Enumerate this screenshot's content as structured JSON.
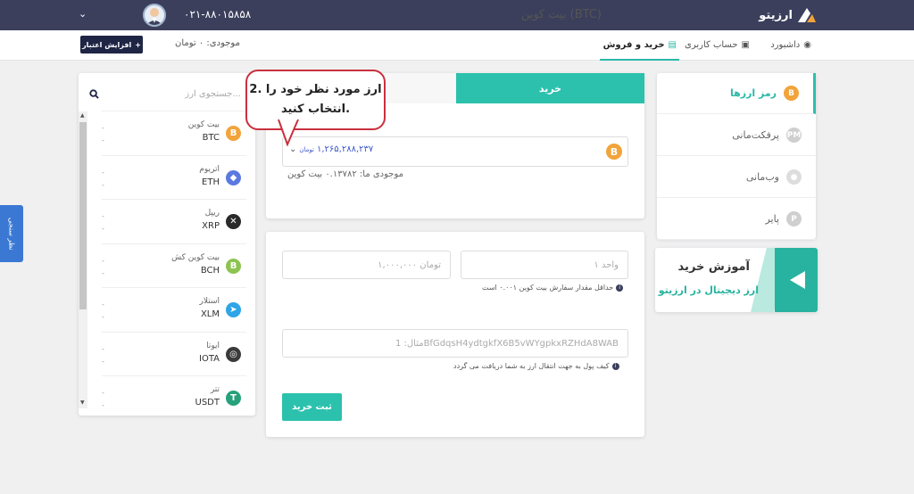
{
  "brand": {
    "name": "ارزیتو"
  },
  "header": {
    "phone": "۰۲۱-۸۸۰۱۵۸۵۸"
  },
  "nav": {
    "items": [
      {
        "label": "داشبورد",
        "icon": "dashboard-icon"
      },
      {
        "label": "حساب کاربری",
        "icon": "user-card-icon"
      },
      {
        "label": "خرید و فروش",
        "icon": "exchange-icon"
      }
    ]
  },
  "account": {
    "balance": "موجودی: ۰ تومان",
    "increase_label": "افزایش اعتبار"
  },
  "search": {
    "placeholder": "جستجوی ارز..."
  },
  "coins": [
    {
      "name": "بیت کوین",
      "symbol": "BTC",
      "color": "#f2a33a",
      "glyph": "B",
      "a": "-",
      "b": "-"
    },
    {
      "name": "اتریوم",
      "symbol": "ETH",
      "color": "#5b7ae0",
      "glyph": "◆",
      "a": "-",
      "b": "-"
    },
    {
      "name": "ریپل",
      "symbol": "XRP",
      "color": "#2a2a2a",
      "glyph": "✕",
      "a": "-",
      "b": "-"
    },
    {
      "name": "بیت کوین کش",
      "symbol": "BCH",
      "color": "#8dc451",
      "glyph": "B",
      "a": "-",
      "b": "-"
    },
    {
      "name": "استلار",
      "symbol": "XLM",
      "color": "#2fa4e7",
      "glyph": "➤",
      "a": "-",
      "b": "-"
    },
    {
      "name": "ایوتا",
      "symbol": "IOTA",
      "color": "#3a3a3a",
      "glyph": "◎",
      "a": "-",
      "b": "-"
    },
    {
      "name": "تتر",
      "symbol": "USDT",
      "color": "#26a17b",
      "glyph": "T",
      "a": "-",
      "b": "-"
    }
  ],
  "feedback": {
    "label": "نظر سنجی"
  },
  "trade": {
    "tab_buy": "خرید",
    "callout": "2. ارز مورد نظر خود را انتخاب کنید.",
    "selected_coin": "بیت کوین (BTC)",
    "price": "۱,۲۶۵,۲۸۸,۲۳۷",
    "price_unit": "تومان",
    "stock": "موجودی ما: ۰.۱۳۷۸۲ بیت کوین"
  },
  "form": {
    "units_placeholder": "۱ واحد",
    "toman_placeholder": "۱,۰۰۰,۰۰۰ تومان",
    "min_hint": "حداقل مقدار سفارش بیت کوین ۰.۰۰۱ است",
    "wallet_placeholder": "مثال: 1BfGdqsH4ydtgkfX6B5vWYgpkxRZHdA8WAB",
    "wallet_hint": "کیف پول به جهت انتقال ارز به شما دریافت می گردد",
    "submit": "ثبت خرید"
  },
  "menu": [
    {
      "label": "رمز ارزها",
      "color": "#f2a33a",
      "glyph": "B",
      "active": true
    },
    {
      "label": "پرفکت‌مانی",
      "color": "#cfcfcf",
      "glyph": "PM",
      "active": false
    },
    {
      "label": "وب‌مانی",
      "color": "#dddddd",
      "glyph": "●",
      "active": false
    },
    {
      "label": "پایر",
      "color": "#cfcfcf",
      "glyph": "P",
      "active": false
    }
  ],
  "education": {
    "title": "آموزش خرید",
    "subtitle": "ارز دیجیتال در ارزیتو"
  },
  "colors": {
    "accent": "#2bc1ad",
    "header": "#3b3f5c",
    "callout_border": "#c9303e",
    "price": "#3d58c9"
  }
}
